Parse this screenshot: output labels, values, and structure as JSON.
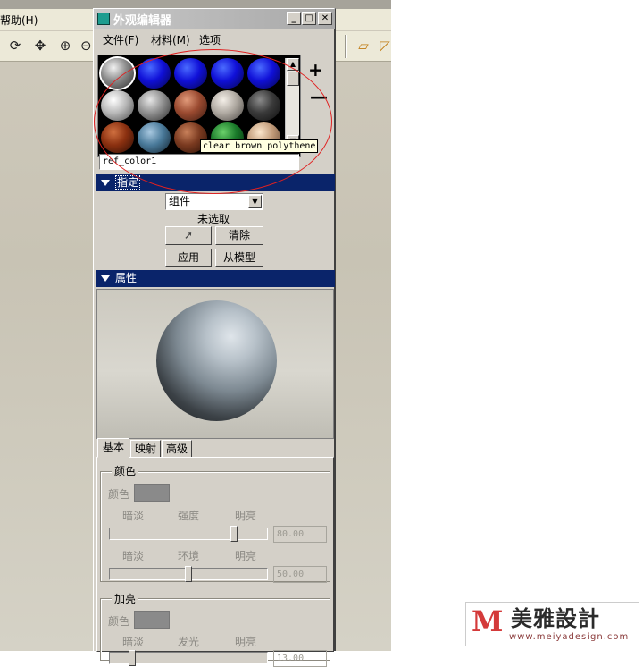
{
  "background_app": {
    "menu_help": "帮助(H)"
  },
  "dialog": {
    "title": "外观编辑器",
    "menus": [
      "文件(F)",
      "材料(M)",
      "选项"
    ],
    "add_label": "+",
    "remove_label": "—",
    "tooltip": "clear brown polythene",
    "material_name": "ref_color1",
    "assign_section": {
      "header": "指定",
      "scope_value": "组件",
      "selection_status": "未选取",
      "clear_button": "清除",
      "apply_button": "应用",
      "from_model_button": "从模型"
    },
    "properties_section": {
      "header": "属性"
    },
    "tabs": [
      "基本",
      "映射",
      "高级"
    ],
    "basic": {
      "color_group": {
        "label": "颜色",
        "color_label": "颜色",
        "color_hex": "#8a8a8a",
        "slider1": {
          "left": "暗淡",
          "mid": "强度",
          "right": "明亮",
          "value": "80.00",
          "position": 0.8
        },
        "slider2": {
          "left": "暗淡",
          "mid": "环境",
          "right": "明亮",
          "value": "50.00",
          "position": 0.5
        }
      },
      "highlight_group": {
        "label": "加亮",
        "color_label": "颜色",
        "color_hex": "#8a8a8a",
        "slider1": {
          "left": "暗淡",
          "mid": "发光",
          "right": "明亮",
          "value": "13.00",
          "position": 0.13
        }
      }
    }
  },
  "swatches": [
    {
      "name": "white-glossy",
      "c1": "#f2f2f2",
      "c2": "#8a8a8a",
      "c3": "#2a2a2a"
    },
    {
      "name": "blue",
      "c1": "#4a6bff",
      "c2": "#1010d8",
      "c3": "#05054a"
    },
    {
      "name": "blue",
      "c1": "#4a6bff",
      "c2": "#1010d8",
      "c3": "#05054a"
    },
    {
      "name": "blue",
      "c1": "#4a6bff",
      "c2": "#1010d8",
      "c3": "#05054a"
    },
    {
      "name": "blue",
      "c1": "#4a6bff",
      "c2": "#1010d8",
      "c3": "#05054a"
    },
    {
      "name": "white-matte",
      "c1": "#ffffff",
      "c2": "#b8b8b8",
      "c3": "#4a4a4a"
    },
    {
      "name": "silver",
      "c1": "#e6e6e6",
      "c2": "#909090",
      "c3": "#2c2c2c"
    },
    {
      "name": "copper",
      "c1": "#e19a7a",
      "c2": "#9a4a30",
      "c3": "#3a1a10"
    },
    {
      "name": "pearl",
      "c1": "#f4efe8",
      "c2": "#b0aaa2",
      "c3": "#4a4642"
    },
    {
      "name": "dark-gray",
      "c1": "#8a8a8a",
      "c2": "#3a3a3a",
      "c3": "#0e0e0e"
    },
    {
      "name": "rust",
      "c1": "#d07040",
      "c2": "#8a3010",
      "c3": "#2a0c04"
    },
    {
      "name": "steel-blue",
      "c1": "#a8c8e0",
      "c2": "#4a7a9a",
      "c3": "#12222e"
    },
    {
      "name": "brown",
      "c1": "#c8805a",
      "c2": "#7a3a20",
      "c3": "#2a1006"
    },
    {
      "name": "green",
      "c1": "#6ad06a",
      "c2": "#1a7a2a",
      "c3": "#052a0a"
    },
    {
      "name": "beige",
      "c1": "#fbe6cc",
      "c2": "#c09a78",
      "c3": "#5a4030"
    }
  ],
  "watermark": {
    "logo_letter": "M",
    "name": "美雅設計",
    "url": "www.meiyadesign.com"
  }
}
